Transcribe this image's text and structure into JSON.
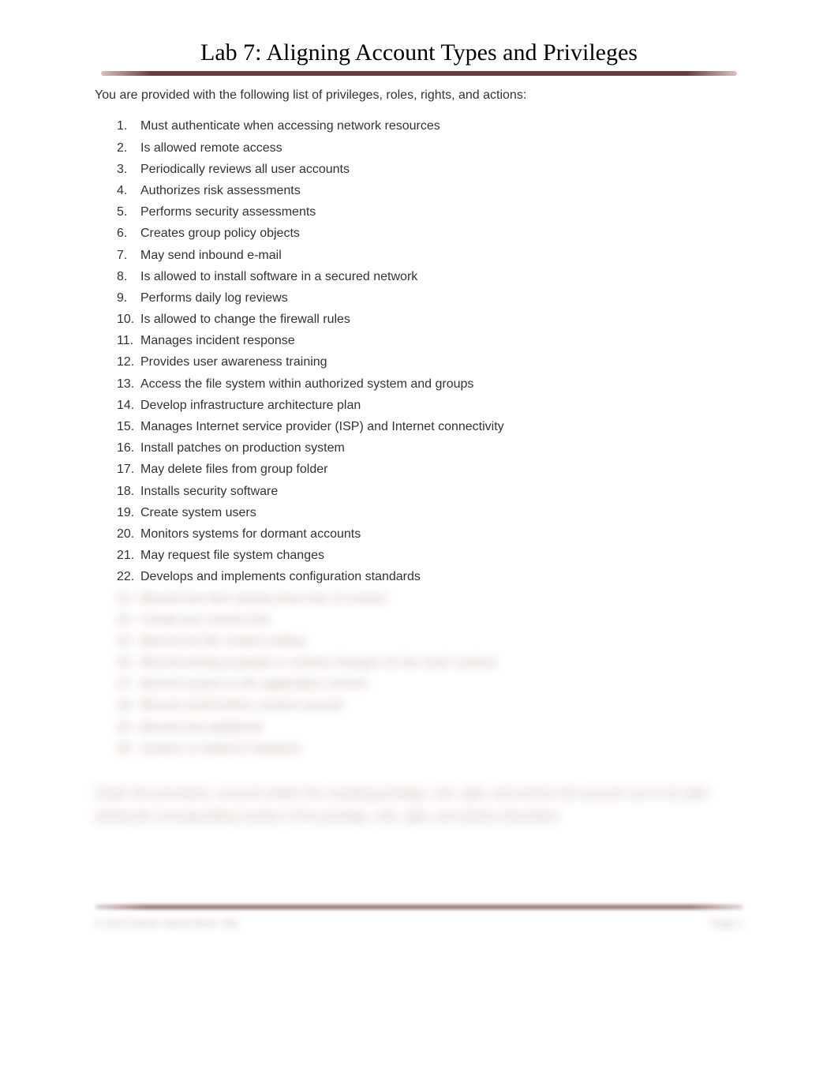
{
  "title": "Lab 7: Aligning Account Types and Privileges",
  "intro": "You are provided with the following list of privileges, roles, rights, and actions:",
  "items_visible": [
    "Must authenticate when accessing network resources",
    "Is allowed remote access",
    "Periodically reviews all user accounts",
    "Authorizes risk assessments",
    "Performs security assessments",
    "Creates group policy objects",
    "May send inbound e-mail",
    "Is allowed to install software in a secured network",
    "Performs daily log reviews",
    "Is allowed to change the firewall rules",
    "Manages incident response",
    "Provides user awareness training",
    "Access the file system within authorized system and groups",
    "Develop infrastructure architecture plan",
    "Manages Internet service provider (ISP) and Internet connectivity",
    "Install patches on production system",
    "May delete files from group folder",
    "Installs security software",
    "Create system users",
    "Monitors systems for dormant accounts",
    "May request file system changes",
    "Develops and implements configuration standards"
  ],
  "items_blurred": [
    "Blurred text item twenty three line of content",
    "Create text content line",
    "Blurred list file content writing",
    "Blurred writing example is content changes on the each content",
    "Blurred system is the application content",
    "Blurred small before content second",
    "Blurred text additional",
    "System is related in between"
  ],
  "blurred_paragraph": "Under the procedure, account written the resulting privilege, role, right, and actions the account use to be able writing the corresponding number of the privilege, role, right, and actions described.",
  "footer_left": "© 2015 Author Name Book Title",
  "footer_right": "Page 1"
}
